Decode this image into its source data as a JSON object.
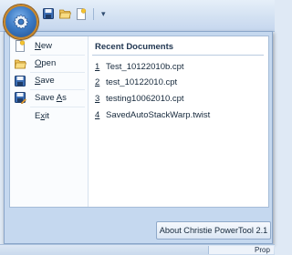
{
  "quick_access": {
    "items": [
      {
        "icon": "save-icon"
      },
      {
        "icon": "open-folder-icon"
      },
      {
        "icon": "new-document-icon"
      }
    ],
    "more_label": "▾"
  },
  "menu": {
    "commands": [
      {
        "label": "New",
        "accel": "N",
        "icon": "new-document-icon"
      },
      {
        "label": "Open",
        "accel": "O",
        "icon": "open-folder-icon"
      },
      {
        "label": "Save",
        "accel": "S",
        "icon": "save-icon"
      },
      {
        "label": "Save As",
        "accel": "A",
        "icon": "save-as-icon"
      },
      {
        "label": "Exit",
        "accel": "x",
        "icon": "none"
      }
    ],
    "recent": {
      "title": "Recent Documents",
      "items": [
        {
          "num": "1",
          "name": "Test_10122010b.cpt"
        },
        {
          "num": "2",
          "name": "test_10122010.cpt"
        },
        {
          "num": "3",
          "name": "testing10062010.cpt"
        },
        {
          "num": "4",
          "name": "SavedAutoStackWarp.twist"
        }
      ]
    },
    "about_label": "About Christie PowerTool 2.1"
  },
  "status": {
    "tab_label": "Prop"
  },
  "colors": {
    "accent": "#3d7cc6",
    "menu_bg": "#c5d8ef",
    "pane_bg": "#ffffff"
  }
}
